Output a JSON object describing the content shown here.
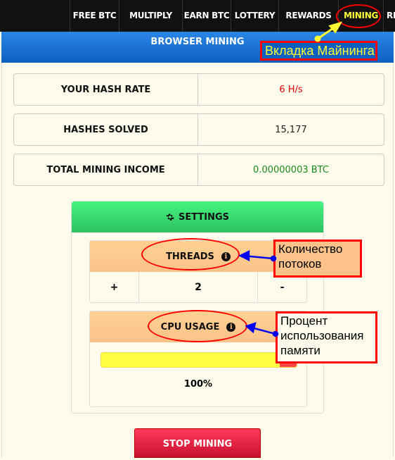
{
  "nav": {
    "items": [
      {
        "label": "FREE BTC"
      },
      {
        "label": "MULTIPLY BTC"
      },
      {
        "label": "EARN BTC"
      },
      {
        "label": "LOTTERY"
      },
      {
        "label": "REWARDS"
      },
      {
        "label": "MINING",
        "active": true
      },
      {
        "label": "RE"
      }
    ]
  },
  "header": {
    "title": "BROWSER MINING"
  },
  "stats": [
    {
      "label": "YOUR HASH RATE",
      "value": "6 H/s",
      "color": "#e00000"
    },
    {
      "label": "HASHES SOLVED",
      "value": "15,177",
      "color": "#222222"
    },
    {
      "label": "TOTAL MINING INCOME",
      "value": "0.00000003 BTC",
      "color": "#1a8a1a"
    }
  ],
  "settings": {
    "title": "SETTINGS",
    "icon": "gear-icon",
    "threads": {
      "label": "THREADS",
      "plus_label": "+",
      "value": "2",
      "minus_label": "-"
    },
    "cpu": {
      "label": "CPU USAGE",
      "percent_label": "100%",
      "value_percent": 100
    }
  },
  "stop_button": {
    "label": "STOP MINING"
  },
  "annotations": {
    "mining_tab": "Вкладка Майнинга",
    "threads": "Количество потоков",
    "cpu": "Процент использования памяти"
  },
  "colors": {
    "accent_yellow": "#ffff33",
    "annotation_red": "#ff0000",
    "arrow_blue": "#0000ee"
  }
}
